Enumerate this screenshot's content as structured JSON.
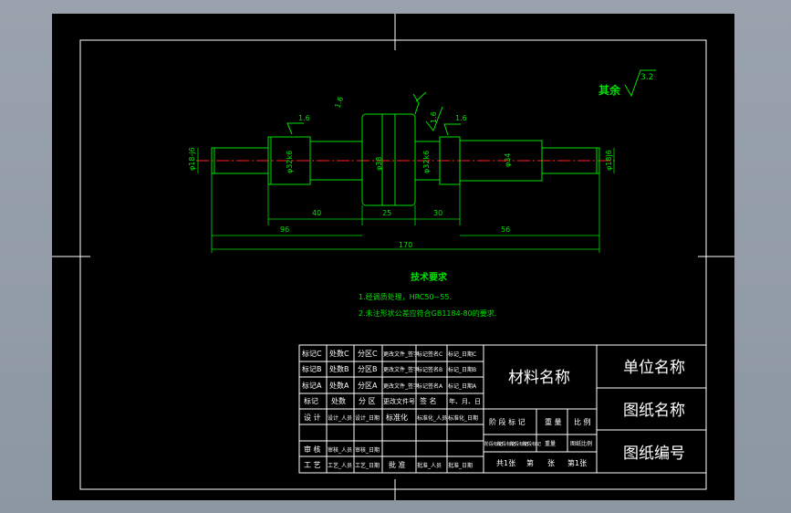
{
  "colors": {
    "background": "#000000",
    "frame": "#ffffff",
    "part_outline": "#00e000",
    "center_line": "#ff2020",
    "annotation_text": "#00e000",
    "table_text": "#ffffff"
  },
  "drawing": {
    "finish_note": {
      "prefix": "其余",
      "value": "3.2"
    },
    "roughness_marks": [
      "1.6",
      "1.6",
      "1.6",
      "1.6"
    ],
    "diameters": {
      "left_end": "φ18-j6",
      "left_journal": "φ32k6",
      "collar": "φ38",
      "right_journal": "φ32k6",
      "right_mid": "φ34",
      "right_end": "φ18j6"
    },
    "dimensions": {
      "d40": "40",
      "d25": "25",
      "d30": "30",
      "d96": "96",
      "d56": "56",
      "total": "170"
    }
  },
  "tech_requirements": {
    "title": "技术要求",
    "items": [
      "1.经调质处理，HRC50~55.",
      "2.未注形状公差应符合GB1184-80的要求."
    ]
  },
  "title_block": {
    "revision_rows": [
      [
        "标记C",
        "处数C",
        "分区C",
        "更改文件_签字",
        "标记签名C",
        "标记_日期C"
      ],
      [
        "标记B",
        "处数B",
        "分区B",
        "更改文件_签字",
        "标记签名B",
        "标记_日期B"
      ],
      [
        "标记A",
        "处数A",
        "分区A",
        "更改文件_签字",
        "标记签名A",
        "标记_日期A"
      ],
      [
        "标记",
        "处数",
        "分 区",
        "更改文件号",
        "签 名",
        "年、月、日"
      ]
    ],
    "sign_rows": [
      [
        "设 计",
        "设计_人员",
        "设计_日期",
        "标准化",
        "标准化_人员",
        "标准化_日期"
      ],
      [
        "",
        "",
        "",
        "",
        "",
        ""
      ],
      [
        "审 核",
        "审核_人员",
        "审核_日期",
        "",
        "",
        ""
      ],
      [
        "工 艺",
        "工艺_人员",
        "工艺_日期",
        "批 准",
        "批准_人员",
        "批准_日期"
      ]
    ],
    "material": "材料名称",
    "stage_headers": [
      "阶 段 标 记",
      "重 量",
      "比 例"
    ],
    "stage_values": [
      "阶段标记",
      "阶段标记",
      "阶段标记",
      "阶段标记",
      "重量",
      "图纸比例"
    ],
    "sheet_info": [
      "共1张",
      "第",
      "张",
      "第1张"
    ],
    "unit_name": "单位名称",
    "drawing_name": "图纸名称",
    "drawing_number": "图纸编号"
  }
}
